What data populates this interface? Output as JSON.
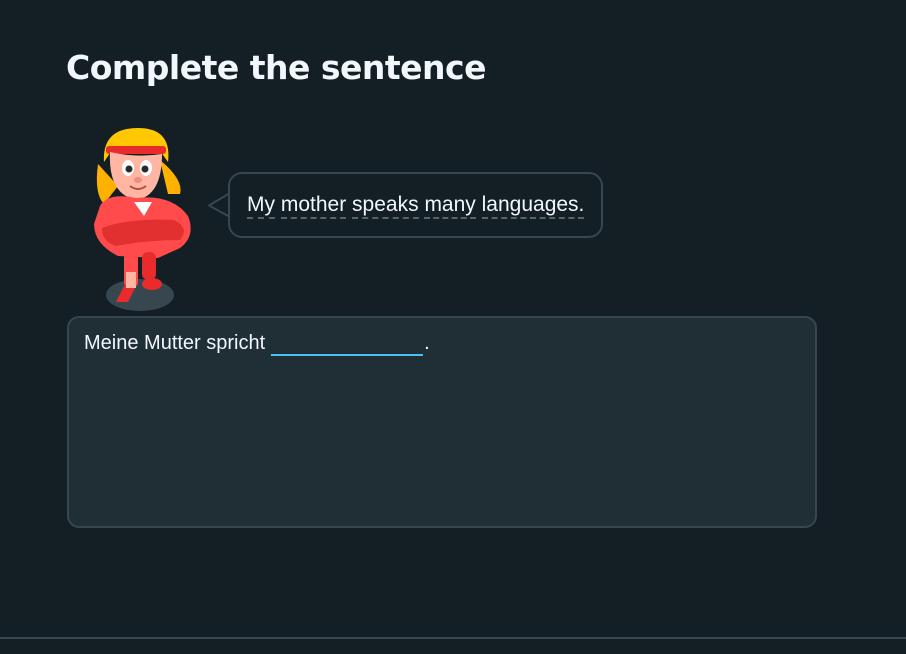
{
  "exercise": {
    "title": "Complete the sentence"
  },
  "speech_bubble": {
    "words": [
      "My",
      "mother",
      "speaks",
      "many",
      "languages."
    ]
  },
  "answer": {
    "prefix": "Meine Mutter spricht",
    "input_value": "",
    "suffix": "."
  },
  "colors": {
    "background": "#141f25",
    "panel": "#202f36",
    "border": "#37464f",
    "text": "#f1f7fb",
    "input_underline": "#49c0f8"
  },
  "icons": {
    "character": "character-illustration"
  }
}
